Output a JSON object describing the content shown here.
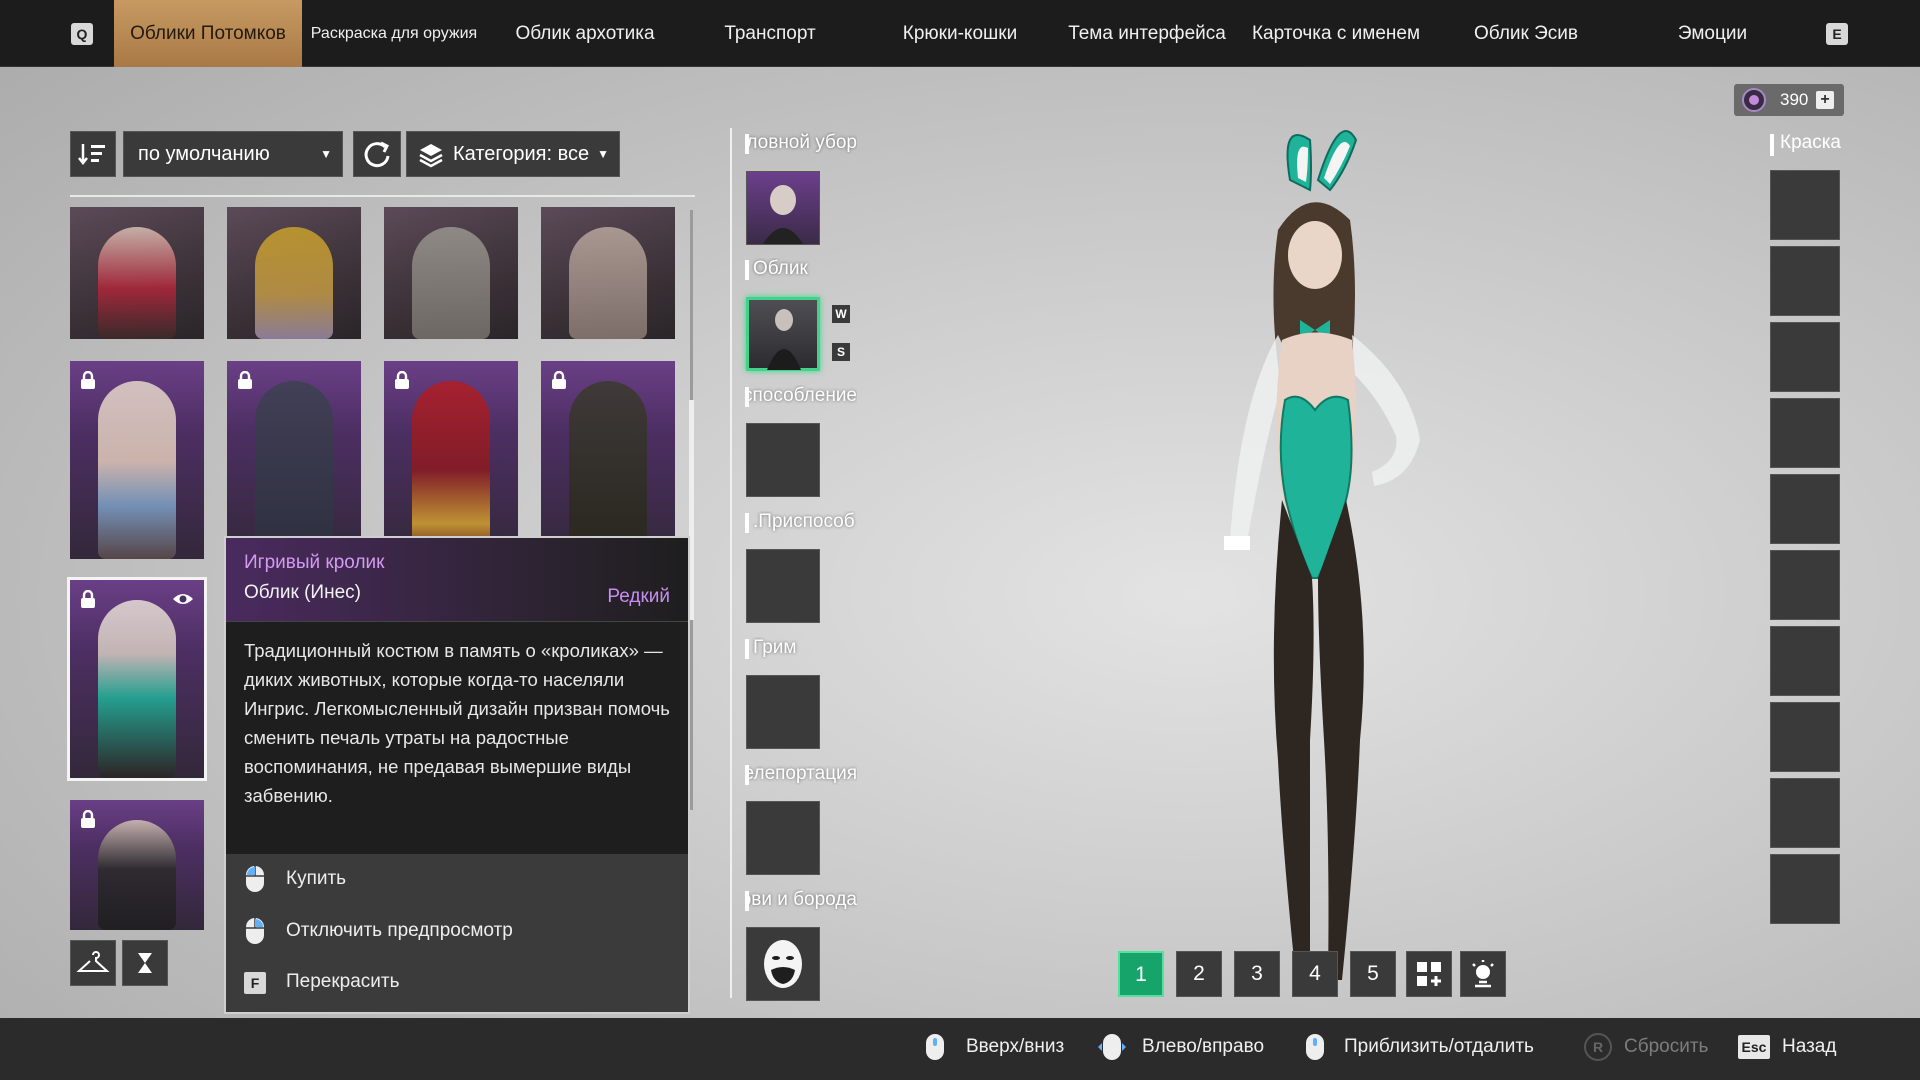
{
  "nav": {
    "left_key": "Q",
    "right_key": "E",
    "tabs": [
      {
        "label": "Облики Потомков",
        "active": true
      },
      {
        "label": "Раскраска для оружия"
      },
      {
        "label": "Облик архотика"
      },
      {
        "label": "Транспорт"
      },
      {
        "label": "Крюки-кошки"
      },
      {
        "label": "Тема интерфейса"
      },
      {
        "label": "Карточка с именем"
      },
      {
        "label": "Облик Эсив"
      },
      {
        "label": "Эмоции"
      }
    ]
  },
  "filters": {
    "sort_value": "по умолчанию",
    "category_label": "Категория: все"
  },
  "tooltip": {
    "name": "Игривый кролик",
    "subtitle": "Облик (Инес)",
    "rarity": "Редкий",
    "description": "Традиционный костюм в память о «кроликах» — диких животных, которые когда-то населяли Ингрис. Легкомысленный дизайн призван помочь сменить печаль утраты на радостные воспоминания, не предавая вымершие виды забвению.",
    "actions": {
      "buy": "Купить",
      "toggle_preview": "Отключить предпросмотр",
      "recolor_key": "F",
      "recolor": "Перекрасить"
    }
  },
  "slots": {
    "headwear": "Головной убор",
    "skin": "Облик",
    "skin_key_up": "W",
    "skin_key_down": "S",
    "adornment": "Приспособление",
    "device": "Приспособ.",
    "makeup": "Грим",
    "teleport": "Телепортация",
    "eyebrows": "Брови и борода"
  },
  "currency": {
    "amount": "390",
    "add": "+"
  },
  "paint": {
    "label": "Краска"
  },
  "presets": [
    "1",
    "2",
    "3",
    "4",
    "5"
  ],
  "bottom_hints": {
    "updown": "Вверх/вниз",
    "leftright": "Влево/вправо",
    "zoom": "Приблизить/отдалить",
    "reset_key": "R",
    "reset": "Сбросить",
    "back_key": "Esc",
    "back": "Назад"
  },
  "colors": {
    "accent_tab": "#b98653",
    "rarity": "#c98cf0",
    "selected_slot": "#3fd48a",
    "preset_active": "#17a46b",
    "outfit": "#1fb39a"
  }
}
